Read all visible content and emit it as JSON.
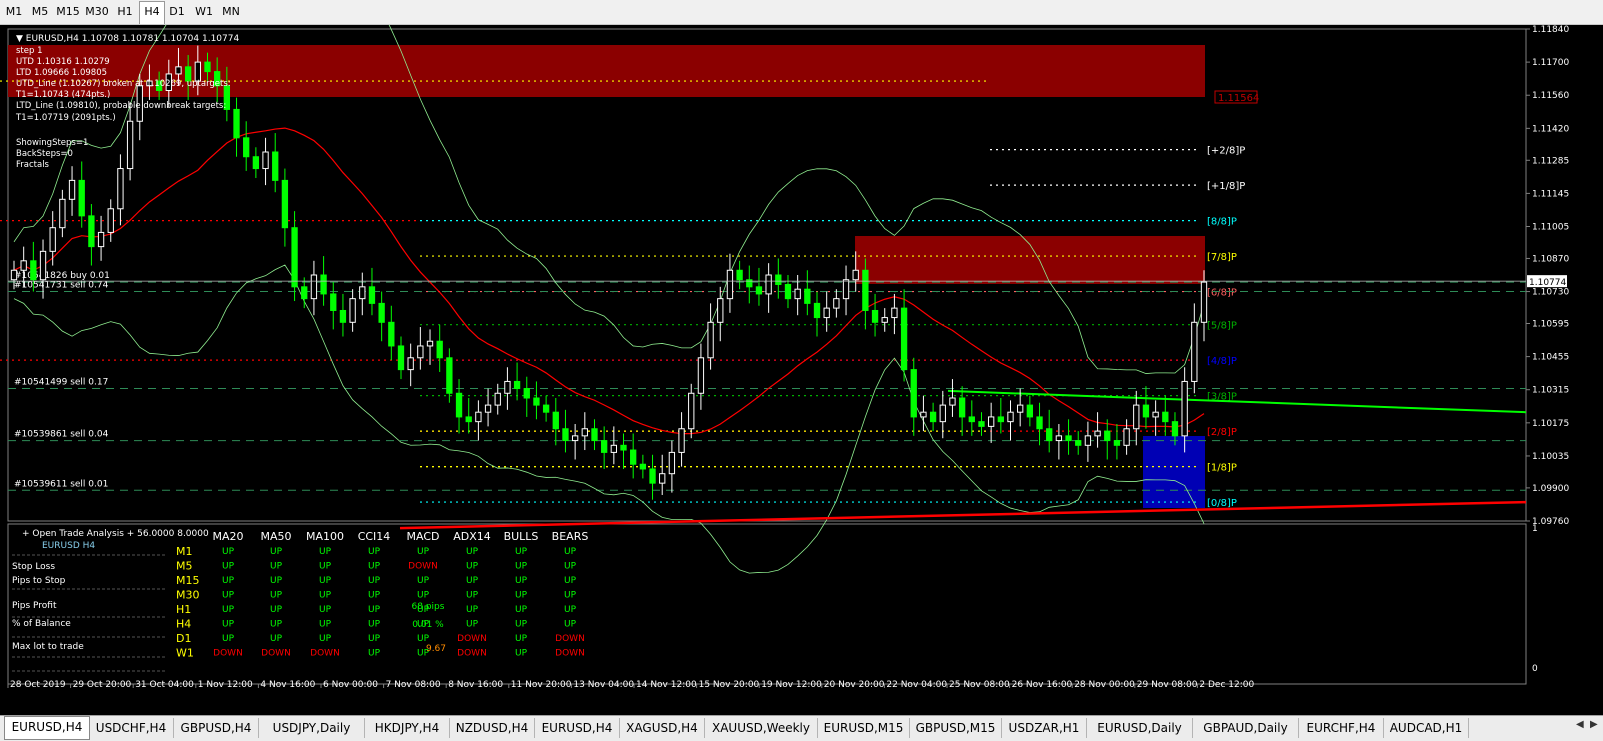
{
  "timeframes": [
    "M1",
    "M5",
    "M15",
    "M30",
    "H1",
    "H4",
    "D1",
    "W1",
    "MN"
  ],
  "active_timeframe": "H4",
  "symbol_tabs": [
    "EURUSD,H4",
    "USDCHF,H4",
    "GBPUSD,H4",
    "USDJPY,Daily",
    "HKDJPY,H4",
    "NZDUSD,H4",
    "EURUSD,H4",
    "XAGUSD,H4",
    "XAUUSD,Weekly",
    "EURUSD,M15",
    "GBPUSD,M15",
    "USDZAR,H1",
    "EURUSD,Daily",
    "GBPAUD,Daily",
    "EURCHF,H4",
    "AUDCAD,H1"
  ],
  "active_tab": 0,
  "colors": {
    "bull": "#ffffff",
    "bear": "#00ff00",
    "green": "#00ff00",
    "red": "#ff0000",
    "darkred": "#8b0000",
    "blue": "#0000b4",
    "yellow": "#ffff00",
    "grid": "#3a3a3a"
  },
  "chart_data": {
    "type": "candlestick",
    "symbol_header": "EURUSD,H4  1.10708 1.10781 1.10704 1.10774",
    "x_tick_labels": [
      "28 Oct 2019",
      "29 Oct 20:00",
      "31 Oct 04:00",
      "1 Nov 12:00",
      "4 Nov 16:00",
      "6 Nov 00:00",
      "7 Nov 08:00",
      "8 Nov 16:00",
      "11 Nov 20:00",
      "13 Nov 04:00",
      "14 Nov 12:00",
      "15 Nov 20:00",
      "19 Nov 12:00",
      "20 Nov 20:00",
      "22 Nov 04:00",
      "25 Nov 08:00",
      "26 Nov 16:00",
      "28 Nov 00:00",
      "29 Nov 08:00",
      "2 Dec 12:00"
    ],
    "y_tick_labels": [
      "1.11840",
      "1.11700",
      "1.11560",
      "1.11420",
      "1.11285",
      "1.11145",
      "1.11005",
      "1.10870",
      "1.10730",
      "1.10595",
      "1.10455",
      "1.10315",
      "1.10175",
      "1.10035",
      "1.09900",
      "1.09760"
    ],
    "ylim": [
      1.0976,
      1.1184
    ],
    "current_price": "1.10774",
    "info_text": [
      "step 1",
      "UTD 1.10316  1.10279",
      "LTD  1.09666  1.09805",
      "UTD_Line (1.10267) broken at 1.10269, uptargets:",
      "T1=1.10743 (474pts.)",
      "LTD_Line (1.09810), probable downbreak targets:",
      "T1=1.07719 (2091pts.)",
      "ShowingSteps=1",
      "BackSteps=0",
      "Fractals"
    ],
    "murrey_levels": [
      {
        "label": "[+2/8]P",
        "price": 1.1133,
        "color": "#ffffff"
      },
      {
        "label": "[+1/8]P",
        "price": 1.1118,
        "color": "#ffffff"
      },
      {
        "label": "[8/8]P",
        "price": 1.1103,
        "color": "#00ffff"
      },
      {
        "label": "[7/8]P",
        "price": 1.1088,
        "color": "#ffff00"
      },
      {
        "label": "[6/8]P",
        "price": 1.1073,
        "color": "#ff6060"
      },
      {
        "label": "[5/8]P",
        "price": 1.1059,
        "color": "#00b000"
      },
      {
        "label": "[4/8]P",
        "price": 1.1044,
        "color": "#0000ff"
      },
      {
        "label": "[3/8]P",
        "price": 1.1029,
        "color": "#00b000"
      },
      {
        "label": "[2/8]P",
        "price": 1.1014,
        "color": "#ff0000"
      },
      {
        "label": "[1/8]P",
        "price": 1.0999,
        "color": "#ffff00"
      },
      {
        "label": "[0/8]P",
        "price": 1.0984,
        "color": "#00ffff"
      }
    ],
    "resistance_label": "1.11564",
    "trade_lines": [
      {
        "label": "#10541826 buy 0.01",
        "price": 1.1077
      },
      {
        "label": "#10541731 sell 0.74",
        "price": 1.1073
      },
      {
        "label": "#10541499 sell 0.17",
        "price": 1.1032
      },
      {
        "label": "#10539861 sell 0.04",
        "price": 1.101
      },
      {
        "label": "#10539611 sell 0.01",
        "price": 1.0989
      }
    ],
    "closes": [
      1.1082,
      1.1086,
      1.1078,
      1.109,
      1.11,
      1.1112,
      1.112,
      1.1105,
      1.1092,
      1.1098,
      1.1108,
      1.1125,
      1.1145,
      1.116,
      1.1162,
      1.1158,
      1.1165,
      1.1168,
      1.1162,
      1.117,
      1.1166,
      1.116,
      1.115,
      1.1138,
      1.113,
      1.1125,
      1.1132,
      1.112,
      1.11,
      1.1075,
      1.107,
      1.108,
      1.1072,
      1.1065,
      1.106,
      1.107,
      1.1075,
      1.1068,
      1.106,
      1.105,
      1.104,
      1.1045,
      1.105,
      1.1052,
      1.1045,
      1.103,
      1.102,
      1.1018,
      1.1022,
      1.1025,
      1.103,
      1.1035,
      1.1032,
      1.1028,
      1.1025,
      1.1022,
      1.1015,
      1.101,
      1.1012,
      1.1015,
      1.101,
      1.1005,
      1.1008,
      1.1006,
      1.1,
      1.0998,
      1.0992,
      1.0996,
      1.1005,
      1.1015,
      1.103,
      1.1045,
      1.106,
      1.107,
      1.1082,
      1.1078,
      1.1075,
      1.1072,
      1.108,
      1.1076,
      1.107,
      1.1074,
      1.1068,
      1.1062,
      1.1066,
      1.107,
      1.1078,
      1.1082,
      1.1065,
      1.106,
      1.1062,
      1.1066,
      1.104,
      1.102,
      1.1022,
      1.1018,
      1.1025,
      1.1028,
      1.102,
      1.1018,
      1.1016,
      1.102,
      1.1018,
      1.1022,
      1.1025,
      1.102,
      1.1015,
      1.101,
      1.1012,
      1.101,
      1.1008,
      1.1012,
      1.1014,
      1.101,
      1.1008,
      1.1015,
      1.1025,
      1.102,
      1.1022,
      1.1018,
      1.1012,
      1.1035,
      1.106,
      1.1077
    ],
    "analysis": {
      "title": "+ Open Trade Analysis + 56.0000 8.0000",
      "symbol_label": "EURUSD  H4",
      "left_labels": [
        "Stop Loss",
        "Pips to Stop",
        "Pips Profit",
        "% of Balance",
        "Max lot to trade"
      ],
      "columns": [
        "MA20",
        "MA50",
        "MA100",
        "CCI14",
        "MACD",
        "ADX14",
        "BULLS",
        "BEARS"
      ],
      "rows": [
        {
          "tf": "M1",
          "v": [
            "UP",
            "UP",
            "UP",
            "UP",
            "UP",
            "UP",
            "UP",
            "UP"
          ]
        },
        {
          "tf": "M5",
          "v": [
            "UP",
            "UP",
            "UP",
            "UP",
            "DOWN",
            "UP",
            "UP",
            "UP"
          ]
        },
        {
          "tf": "M15",
          "v": [
            "UP",
            "UP",
            "UP",
            "UP",
            "UP",
            "UP",
            "UP",
            "UP"
          ]
        },
        {
          "tf": "M30",
          "v": [
            "UP",
            "UP",
            "UP",
            "UP",
            "UP",
            "UP",
            "UP",
            "UP"
          ]
        },
        {
          "tf": "H1",
          "v": [
            "UP",
            "UP",
            "UP",
            "UP",
            "UP",
            "UP",
            "UP",
            "UP"
          ]
        },
        {
          "tf": "H4",
          "v": [
            "UP",
            "UP",
            "UP",
            "UP",
            "UP",
            "UP",
            "UP",
            "UP"
          ]
        },
        {
          "tf": "D1",
          "v": [
            "UP",
            "UP",
            "UP",
            "UP",
            "UP",
            "DOWN",
            "UP",
            "DOWN"
          ]
        },
        {
          "tf": "W1",
          "v": [
            "DOWN",
            "DOWN",
            "DOWN",
            "UP",
            "UP",
            "DOWN",
            "UP",
            "DOWN"
          ]
        }
      ],
      "pips_profit": "68 pips",
      "pct_balance": "0.01 %",
      "max_lot": "9.67",
      "subpanel_top_tick": "1",
      "subpanel_bottom_tick": "0"
    }
  }
}
